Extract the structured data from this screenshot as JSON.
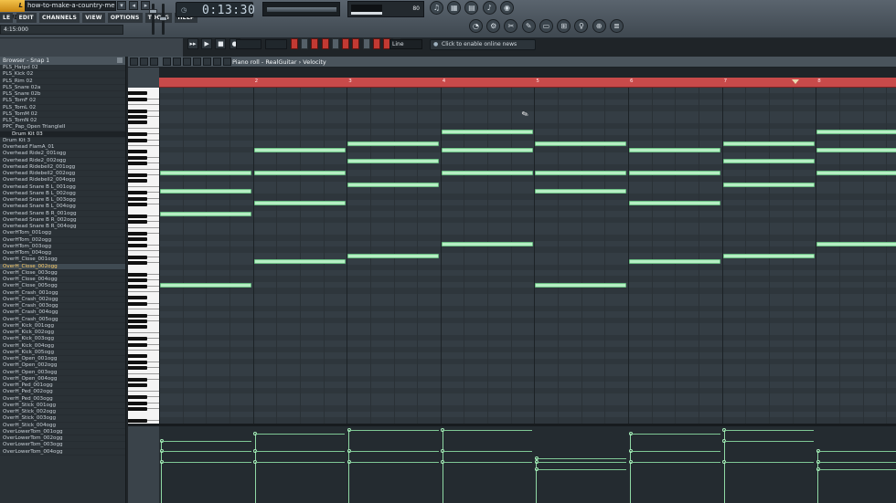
{
  "app": {
    "logo_text": "L STUDIO",
    "song_title": "how-to-make-a-country-melo...",
    "title_buttons": [
      "▾",
      "◂",
      "▸"
    ],
    "menus": [
      "LE",
      "EDIT",
      "CHANNELS",
      "VIEW",
      "OPTIONS",
      "TOOLS",
      "HELP"
    ],
    "hint_time": "4:15:000"
  },
  "transport": {
    "time": "0:13:30",
    "cpu_value": "80",
    "buttons": [
      "▸▸",
      "▶",
      "■",
      "●"
    ],
    "snap_value": "Line",
    "news_text": "Click to enable online news"
  },
  "top_icons": [
    "♫",
    "▦",
    "▤",
    "♪",
    "◉"
  ],
  "tool_icons": [
    "◔",
    "⚙",
    "✂",
    "✎",
    "▭",
    "⊞",
    "♀",
    "⊕",
    "≣"
  ],
  "browser": {
    "title": "Browser - Snap 1",
    "items": [
      {
        "label": "PLS_Hatpd 02"
      },
      {
        "label": "PLS_Kick 02"
      },
      {
        "label": "PLS_Rim 02"
      },
      {
        "label": "PLS_Snare 02a"
      },
      {
        "label": "PLS_Snare 02b"
      },
      {
        "label": "PLS_TomF 02"
      },
      {
        "label": "PLS_TomL 02"
      },
      {
        "label": "PLS_TomM 02"
      },
      {
        "label": "PLS_TomN 02"
      },
      {
        "label": "PPC_Pap_Open TriangleII"
      },
      {
        "label": "Drum Kit 03",
        "type": "folder"
      },
      {
        "label": "Drum Kit 3"
      },
      {
        "label": "Overhead FlamA_01"
      },
      {
        "label": "Overhead Ride2_001ogg"
      },
      {
        "label": "Overhead Ride2_002ogg"
      },
      {
        "label": "Overhead Ridebell2_001ogg"
      },
      {
        "label": "Overhead Ridebell2_002ogg"
      },
      {
        "label": "Overhead Ridebell2_004ogg"
      },
      {
        "label": "Overhead Snare B L_001ogg"
      },
      {
        "label": "Overhead Snare B L_002ogg"
      },
      {
        "label": "Overhead Snare B L_003ogg"
      },
      {
        "label": "Overhead Snare B L_004ogg"
      },
      {
        "label": "Overhead Snare B R_001ogg"
      },
      {
        "label": "Overhead Snare B R_002ogg"
      },
      {
        "label": "Overhead Snare B R_004ogg"
      },
      {
        "label": "OverHTom_001ogg"
      },
      {
        "label": "OverHTom_002ogg"
      },
      {
        "label": "OverHTom_003ogg"
      },
      {
        "label": "OverHTom_004ogg"
      },
      {
        "label": "OverH_Close_001ogg"
      },
      {
        "label": "OverH_Close_002ogg",
        "type": "selected"
      },
      {
        "label": "OverH_Close_003ogg"
      },
      {
        "label": "OverH_Close_004ogg"
      },
      {
        "label": "OverH_Close_005ogg"
      },
      {
        "label": "OverH_Crash_001ogg"
      },
      {
        "label": "OverH_Crash_002ogg"
      },
      {
        "label": "OverH_Crash_003ogg"
      },
      {
        "label": "OverH_Crash_004ogg"
      },
      {
        "label": "OverH_Crash_005ogg"
      },
      {
        "label": "OverH_Kick_001ogg"
      },
      {
        "label": "OverH_Kick_002ogg"
      },
      {
        "label": "OverH_Kick_003ogg"
      },
      {
        "label": "OverH_Kick_004ogg"
      },
      {
        "label": "OverH_Kick_005ogg"
      },
      {
        "label": "OverH_Open_001ogg"
      },
      {
        "label": "OverH_Open_002ogg"
      },
      {
        "label": "OverH_Open_003ogg"
      },
      {
        "label": "OverH_Open_004ogg"
      },
      {
        "label": "OverH_Ped_001ogg"
      },
      {
        "label": "OverH_Ped_002ogg"
      },
      {
        "label": "OverH_Ped_003ogg"
      },
      {
        "label": "OverH_Stick_001ogg"
      },
      {
        "label": "OverH_Stick_002ogg"
      },
      {
        "label": "OverH_Stick_003ogg"
      },
      {
        "label": "OverH_Stick_004ogg"
      },
      {
        "label": "OverLowerTom_001ogg"
      },
      {
        "label": "OverLowerTom_002ogg"
      },
      {
        "label": "OverLowerTom_003ogg"
      },
      {
        "label": "OverLowerTom_004ogg"
      }
    ]
  },
  "piano_roll": {
    "title": "Piano roll - RealGuitar",
    "separator": "›",
    "target": "Velocity",
    "bar_numbers": [
      "2",
      "3",
      "4",
      "5",
      "6",
      "7",
      "8"
    ],
    "colors": {
      "note": "#b6eec4",
      "timeline": "#c84a4a",
      "grid": "#343d44"
    },
    "notes": [
      {
        "bar": 1,
        "lane": 14
      },
      {
        "bar": 1,
        "lane": 17
      },
      {
        "bar": 1,
        "lane": 21
      },
      {
        "bar": 1,
        "lane": 33
      },
      {
        "bar": 2,
        "lane": 10
      },
      {
        "bar": 2,
        "lane": 14
      },
      {
        "bar": 2,
        "lane": 19
      },
      {
        "bar": 2,
        "lane": 29
      },
      {
        "bar": 3,
        "lane": 9
      },
      {
        "bar": 3,
        "lane": 12
      },
      {
        "bar": 3,
        "lane": 16
      },
      {
        "bar": 3,
        "lane": 28
      },
      {
        "bar": 4,
        "lane": 7
      },
      {
        "bar": 4,
        "lane": 10
      },
      {
        "bar": 4,
        "lane": 14
      },
      {
        "bar": 4,
        "lane": 26
      },
      {
        "bar": 5,
        "lane": 9
      },
      {
        "bar": 5,
        "lane": 14
      },
      {
        "bar": 5,
        "lane": 17
      },
      {
        "bar": 5,
        "lane": 33
      },
      {
        "bar": 6,
        "lane": 10
      },
      {
        "bar": 6,
        "lane": 14
      },
      {
        "bar": 6,
        "lane": 19
      },
      {
        "bar": 6,
        "lane": 29
      },
      {
        "bar": 7,
        "lane": 9
      },
      {
        "bar": 7,
        "lane": 12
      },
      {
        "bar": 7,
        "lane": 16
      },
      {
        "bar": 7,
        "lane": 28
      },
      {
        "bar": 8,
        "lane": 7
      },
      {
        "bar": 8,
        "lane": 10
      },
      {
        "bar": 8,
        "lane": 14
      },
      {
        "bar": 8,
        "lane": 26
      }
    ],
    "velocities": [
      {
        "bar": 1,
        "levels": [
          0.85,
          0.7,
          0.55
        ]
      },
      {
        "bar": 2,
        "levels": [
          0.95,
          0.7,
          0.55
        ]
      },
      {
        "bar": 3,
        "levels": [
          1.0,
          0.7,
          0.55
        ]
      },
      {
        "bar": 4,
        "levels": [
          1.0,
          0.7,
          0.55
        ]
      },
      {
        "bar": 5,
        "levels": [
          0.6,
          0.55,
          0.45
        ]
      },
      {
        "bar": 6,
        "levels": [
          0.95,
          0.7,
          0.55
        ]
      },
      {
        "bar": 7,
        "levels": [
          1.0,
          0.85,
          0.55
        ]
      },
      {
        "bar": 8,
        "levels": [
          0.7,
          0.55,
          0.45
        ]
      }
    ]
  }
}
